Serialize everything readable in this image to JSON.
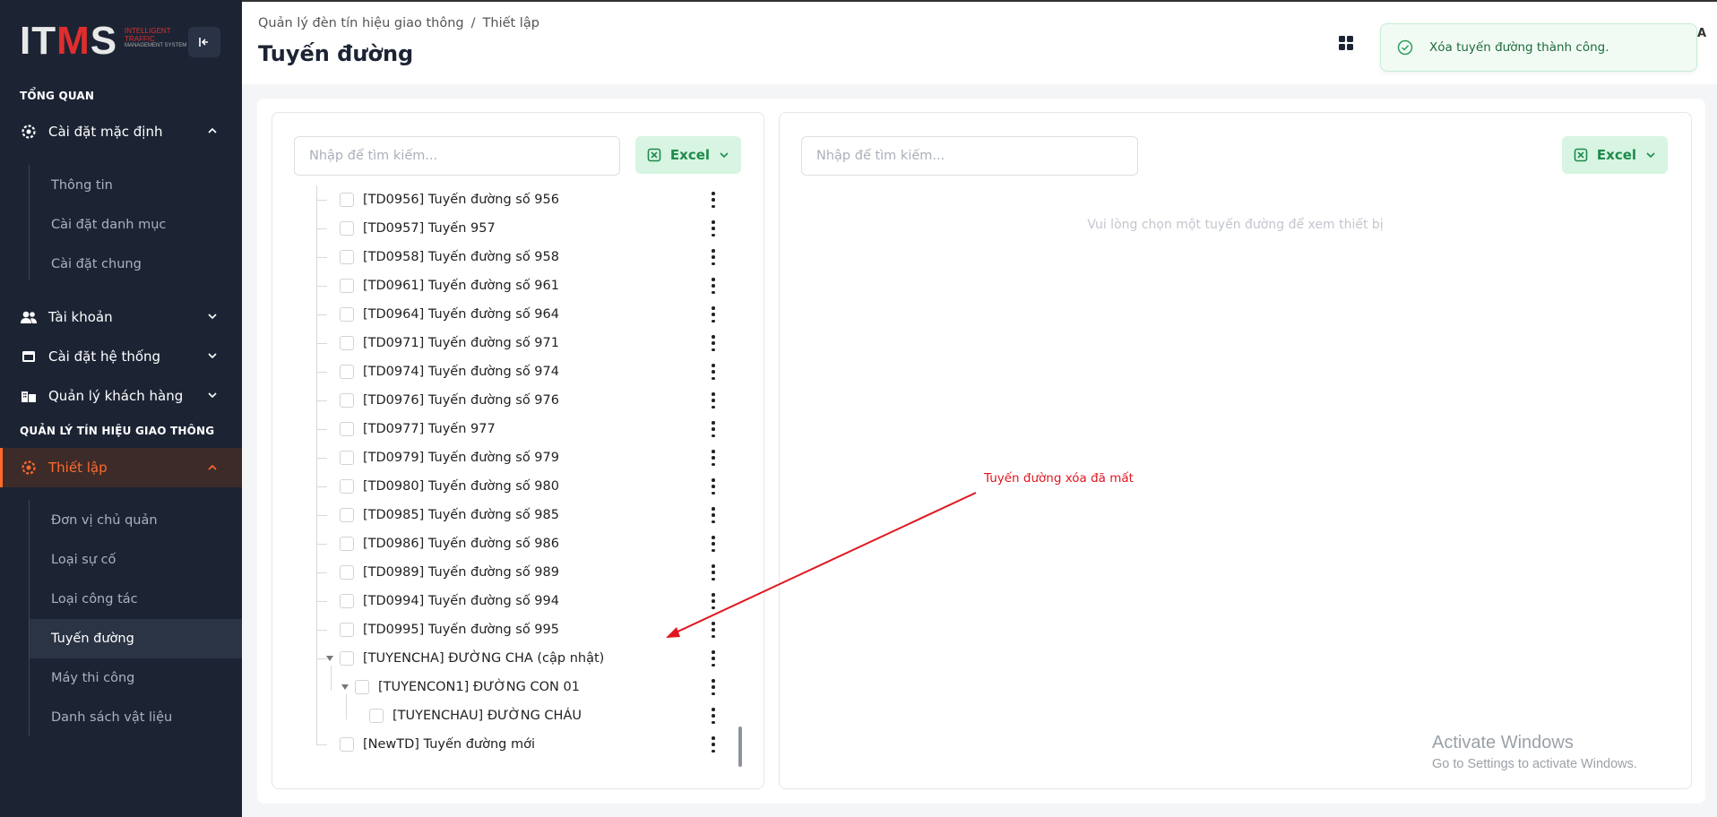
{
  "logo": {
    "text_white": "IT",
    "text_red": "M",
    "text_white2": "S",
    "subtitle": "INTELLIGENT TRAFFIC",
    "subtitle_small": "MANAGEMENT SYSTEM"
  },
  "sidebar": {
    "section_overview": "TỔNG QUAN",
    "default_settings": "Cài đặt mặc định",
    "default_sub": [
      "Thông tin",
      "Cài đặt danh mục",
      "Cài đặt chung"
    ],
    "account": "Tài khoản",
    "system_settings": "Cài đặt hệ thống",
    "customer_mgmt": "Quản lý khách hàng",
    "section_traffic": "QUẢN LÝ TÍN HIỆU GIAO THÔNG",
    "setup": "Thiết lập",
    "setup_sub": [
      "Đơn vị chủ quản",
      "Loại sự cố",
      "Loại công tác",
      "Tuyến đường",
      "Máy thi công",
      "Danh sách vật liệu"
    ],
    "active_sub": "Tuyến đường"
  },
  "header": {
    "breadcrumb": [
      "Quản lý đèn tín hiệu giao thông",
      "/",
      "Thiết lập"
    ],
    "title": "Tuyến đường",
    "partial_letter": "A"
  },
  "toast": {
    "message": "Xóa tuyến đường thành công."
  },
  "left_panel": {
    "search_placeholder": "Nhập để tìm kiếm...",
    "excel_label": "Excel",
    "rows": [
      "[TD0956] Tuyến đường số 956",
      "[TD0957] Tuyến 957",
      "[TD0958] Tuyến đường số 958",
      "[TD0961] Tuyến đường số 961",
      "[TD0964] Tuyến đường số 964",
      "[TD0971] Tuyến đường số 971",
      "[TD0974] Tuyến đường số 974",
      "[TD0976] Tuyến đường số 976",
      "[TD0977] Tuyến 977",
      "[TD0979] Tuyến đường số 979",
      "[TD0980] Tuyến đường số 980",
      "[TD0985] Tuyến đường số 985",
      "[TD0986] Tuyến đường số 986",
      "[TD0989] Tuyến đường số 989",
      "[TD0994] Tuyến đường số 994",
      "[TD0995] Tuyến đường số 995",
      "[TUYENCHA] ĐƯỜNG CHA (cập nhật)",
      "[TUYENCON1] ĐƯỜNG CON 01",
      "[TUYENCHAU] ĐƯỜNG CHÁU",
      "[NewTD] Tuyến đường mới"
    ]
  },
  "right_panel": {
    "search_placeholder": "Nhập để tìm kiếm...",
    "excel_label": "Excel",
    "empty_message": "Vui lòng chọn một tuyến đường để xem thiết bị"
  },
  "annotation": {
    "text": "Tuyến đường xóa đã mất",
    "color": "#e0161f"
  },
  "watermark": {
    "line1": "Activate Windows",
    "line2": "Go to Settings to activate Windows."
  },
  "colors": {
    "accent": "#ff6a2b",
    "sidebar_bg": "#1c2434",
    "excel_green": "#1f8a4c",
    "success": "#1f6b3c"
  }
}
